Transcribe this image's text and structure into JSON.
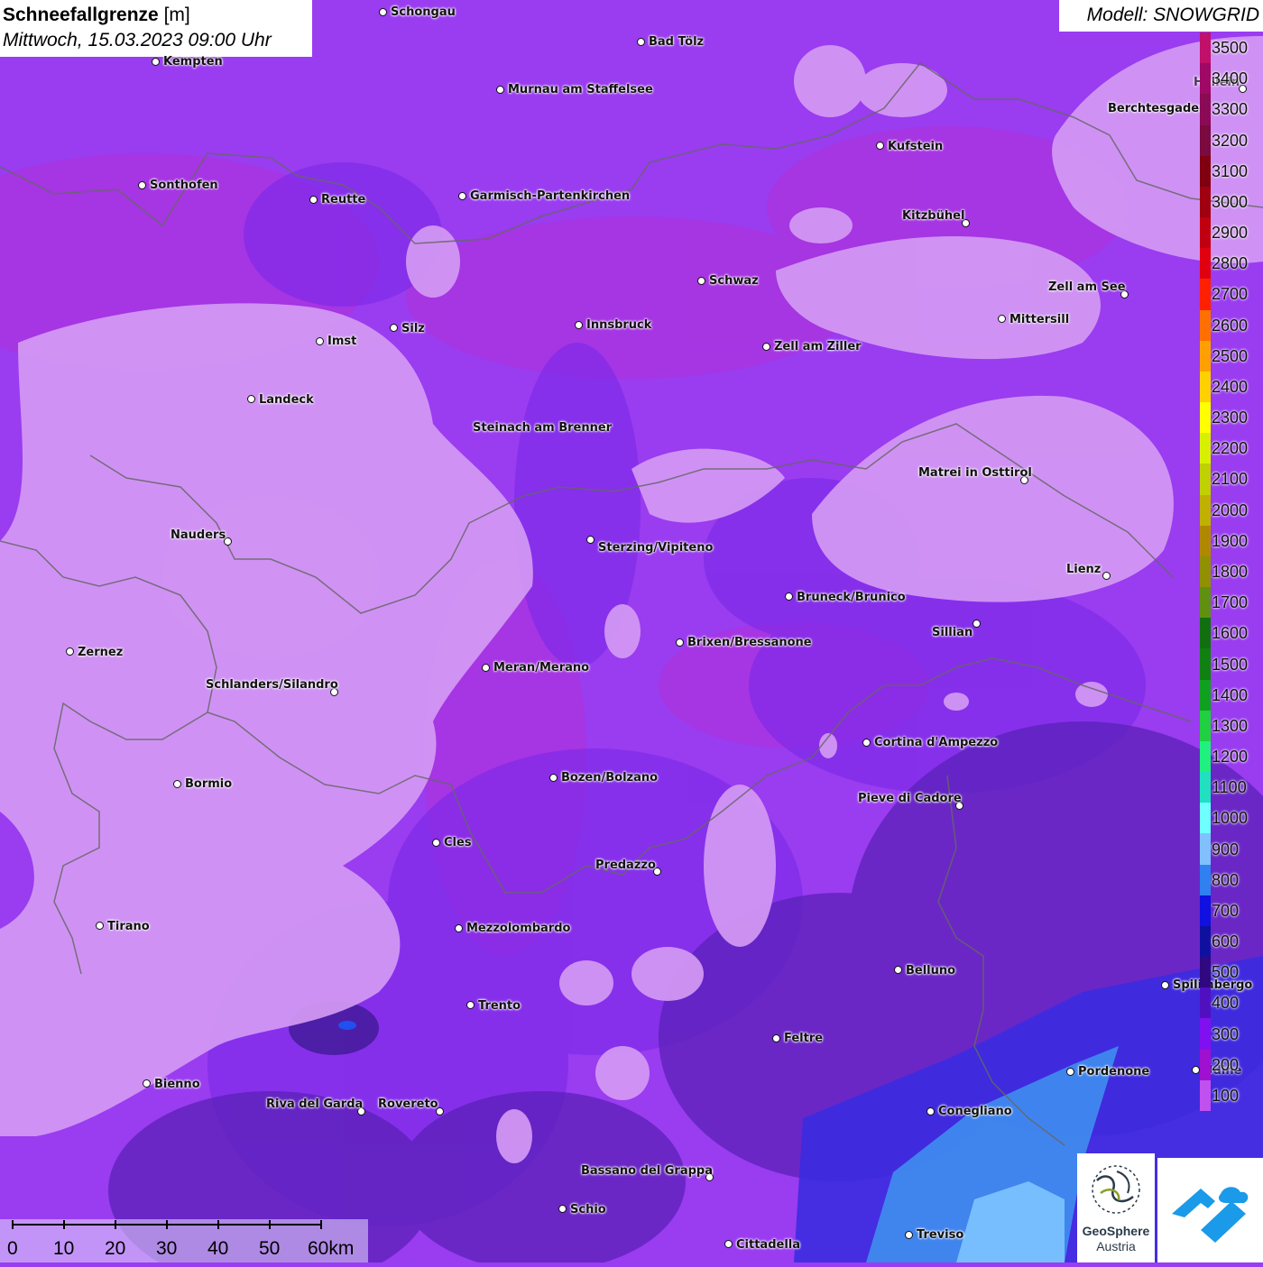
{
  "title": {
    "main": "Schneefallgrenze",
    "unit": "[m]",
    "datetime": "Mittwoch, 15.03.2023 09:00 Uhr"
  },
  "model": "Modell: SNOWGRID",
  "legend": [
    {
      "label": "3500",
      "color": "#c0106a"
    },
    {
      "label": "3400",
      "color": "#a00866"
    },
    {
      "label": "3300",
      "color": "#8b0a55"
    },
    {
      "label": "3200",
      "color": "#7a0a40"
    },
    {
      "label": "3100",
      "color": "#800010"
    },
    {
      "label": "3000",
      "color": "#a00010"
    },
    {
      "label": "2900",
      "color": "#c00010"
    },
    {
      "label": "2800",
      "color": "#e00010"
    },
    {
      "label": "2700",
      "color": "#ff2000"
    },
    {
      "label": "2600",
      "color": "#ff7000"
    },
    {
      "label": "2500",
      "color": "#ffa000"
    },
    {
      "label": "2400",
      "color": "#ffd000"
    },
    {
      "label": "2300",
      "color": "#ffff00"
    },
    {
      "label": "2200",
      "color": "#d8f000"
    },
    {
      "label": "2100",
      "color": "#c0d000"
    },
    {
      "label": "2000",
      "color": "#c0b000"
    },
    {
      "label": "1900",
      "color": "#b08800"
    },
    {
      "label": "1800",
      "color": "#909000"
    },
    {
      "label": "1700",
      "color": "#609010"
    },
    {
      "label": "1600",
      "color": "#107010"
    },
    {
      "label": "1500",
      "color": "#108010"
    },
    {
      "label": "1400",
      "color": "#10a020"
    },
    {
      "label": "1300",
      "color": "#20d040"
    },
    {
      "label": "1200",
      "color": "#20f080"
    },
    {
      "label": "1100",
      "color": "#20e0c0"
    },
    {
      "label": "1000",
      "color": "#70ffff"
    },
    {
      "label": "900",
      "color": "#80c0ff"
    },
    {
      "label": "800",
      "color": "#3080f0"
    },
    {
      "label": "700",
      "color": "#1010e0"
    },
    {
      "label": "600",
      "color": "#1010a0"
    },
    {
      "label": "500",
      "color": "#300880"
    },
    {
      "label": "400",
      "color": "#5010c0"
    },
    {
      "label": "300",
      "color": "#8010f0"
    },
    {
      "label": "200",
      "color": "#a010d0"
    },
    {
      "label": "100",
      "color": "#c050f0"
    }
  ],
  "cities": [
    {
      "name": "Schongau"
    },
    {
      "name": "Bad Tölz"
    },
    {
      "name": "Kempten"
    },
    {
      "name": "Murnau am Staffelsee"
    },
    {
      "name": "Berchtesgaden"
    },
    {
      "name": "Kufstein"
    },
    {
      "name": "Sonthofen"
    },
    {
      "name": "Reutte"
    },
    {
      "name": "Garmisch-Partenkirchen"
    },
    {
      "name": "Kitzbühel"
    },
    {
      "name": "Schwaz"
    },
    {
      "name": "Zell am See"
    },
    {
      "name": "Imst"
    },
    {
      "name": "Silz"
    },
    {
      "name": "Innsbruck"
    },
    {
      "name": "Mittersill"
    },
    {
      "name": "Zell am Ziller"
    },
    {
      "name": "Landeck"
    },
    {
      "name": "Steinach am Brenner"
    },
    {
      "name": "Matrei in Osttirol"
    },
    {
      "name": "Nauders"
    },
    {
      "name": "Sterzing/Vipiteno"
    },
    {
      "name": "Lienz"
    },
    {
      "name": "Bruneck/Brunico"
    },
    {
      "name": "Sillian"
    },
    {
      "name": "Zernez"
    },
    {
      "name": "Brixen/Bressanone"
    },
    {
      "name": "Meran/Merano"
    },
    {
      "name": "Schlanders/Silandro"
    },
    {
      "name": "Cortina d'Ampezzo"
    },
    {
      "name": "Bozen/Bolzano"
    },
    {
      "name": "Bormio"
    },
    {
      "name": "Pieve di Cadore"
    },
    {
      "name": "Cles"
    },
    {
      "name": "Predazzo"
    },
    {
      "name": "Tirano"
    },
    {
      "name": "Mezzolombardo"
    },
    {
      "name": "Belluno"
    },
    {
      "name": "Spilimbergo"
    },
    {
      "name": "Trento"
    },
    {
      "name": "Feltre"
    },
    {
      "name": "Pordenone"
    },
    {
      "name": "Bienno"
    },
    {
      "name": "Riva del Garda"
    },
    {
      "name": "Rovereto"
    },
    {
      "name": "Conegliano"
    },
    {
      "name": "Bassano del Grappa"
    },
    {
      "name": "Schio"
    },
    {
      "name": "Treviso"
    },
    {
      "name": "Cittadella"
    },
    {
      "name": "Hallein"
    },
    {
      "name": "Udine"
    }
  ],
  "scale": {
    "ticks": [
      "0",
      "10",
      "20",
      "30",
      "40",
      "50",
      "60km"
    ]
  },
  "logo": {
    "name": "GeoSphere",
    "sub": "Austria"
  }
}
